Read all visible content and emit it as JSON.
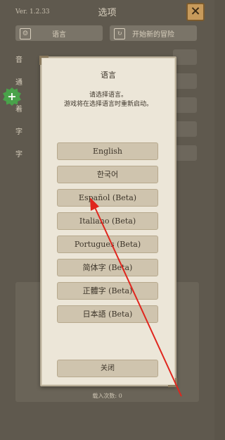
{
  "background": {
    "version": "Ver. 1.2.33",
    "title": "选项",
    "language_button": "语言",
    "new_game_button": "开始新的冒险",
    "rows": [
      "音",
      "通",
      "着",
      "字",
      "字"
    ],
    "footer": "载入次数: 0"
  },
  "modal": {
    "title": "语言",
    "desc_line1": "请选择语言。",
    "desc_line2": "游戏将在选择语言时重新启动。",
    "languages": [
      "English",
      "한국어",
      "Español (Beta)",
      "Italiano (Beta)",
      "Portugues (Beta)",
      "简体字 (Beta)",
      "正體字 (Beta)",
      "日本語 (Beta)"
    ],
    "close_label": "关闭"
  },
  "annotation_color": "#e0261e"
}
